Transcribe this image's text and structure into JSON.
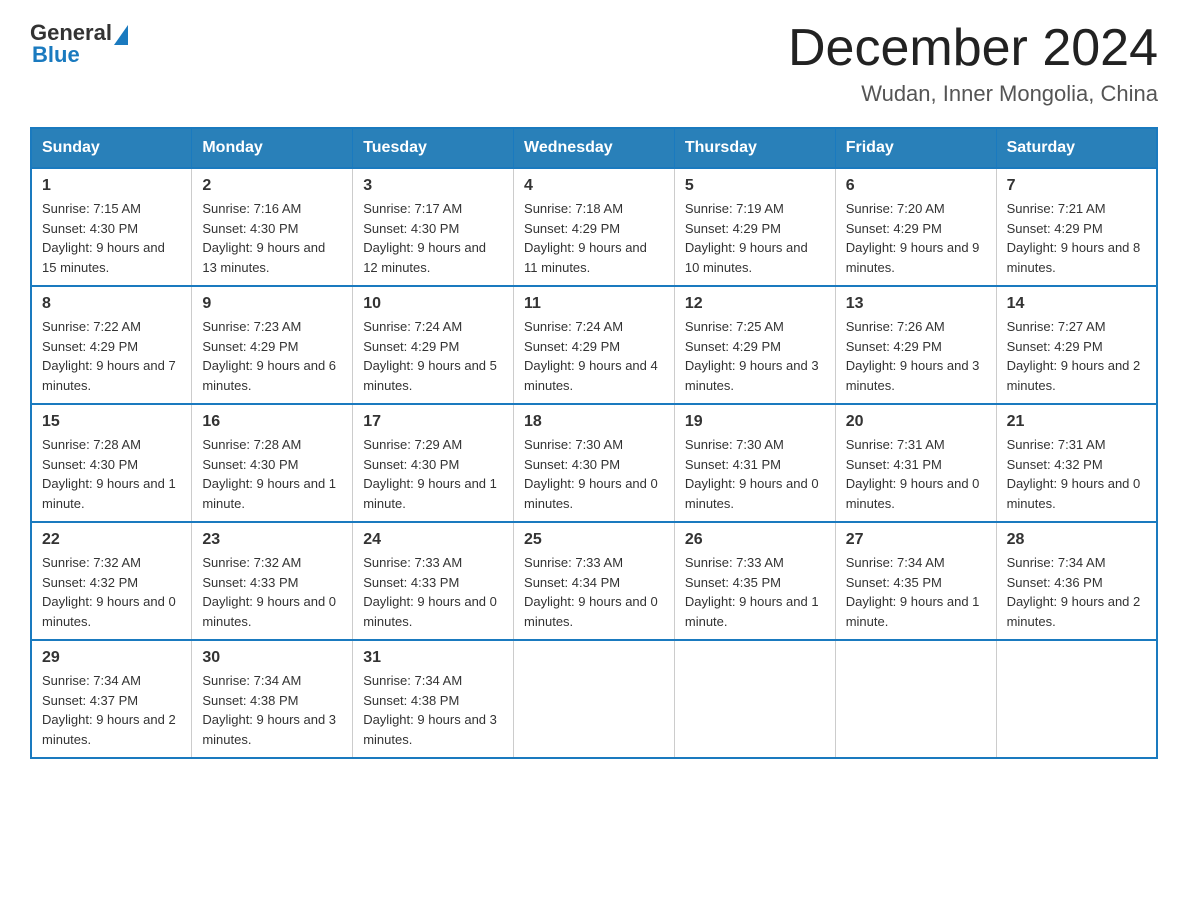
{
  "header": {
    "logo_general": "General",
    "logo_blue": "Blue",
    "month_title": "December 2024",
    "location": "Wudan, Inner Mongolia, China"
  },
  "weekdays": [
    "Sunday",
    "Monday",
    "Tuesday",
    "Wednesday",
    "Thursday",
    "Friday",
    "Saturday"
  ],
  "weeks": [
    [
      {
        "day": "1",
        "sunrise": "7:15 AM",
        "sunset": "4:30 PM",
        "daylight": "9 hours and 15 minutes."
      },
      {
        "day": "2",
        "sunrise": "7:16 AM",
        "sunset": "4:30 PM",
        "daylight": "9 hours and 13 minutes."
      },
      {
        "day": "3",
        "sunrise": "7:17 AM",
        "sunset": "4:30 PM",
        "daylight": "9 hours and 12 minutes."
      },
      {
        "day": "4",
        "sunrise": "7:18 AM",
        "sunset": "4:29 PM",
        "daylight": "9 hours and 11 minutes."
      },
      {
        "day": "5",
        "sunrise": "7:19 AM",
        "sunset": "4:29 PM",
        "daylight": "9 hours and 10 minutes."
      },
      {
        "day": "6",
        "sunrise": "7:20 AM",
        "sunset": "4:29 PM",
        "daylight": "9 hours and 9 minutes."
      },
      {
        "day": "7",
        "sunrise": "7:21 AM",
        "sunset": "4:29 PM",
        "daylight": "9 hours and 8 minutes."
      }
    ],
    [
      {
        "day": "8",
        "sunrise": "7:22 AM",
        "sunset": "4:29 PM",
        "daylight": "9 hours and 7 minutes."
      },
      {
        "day": "9",
        "sunrise": "7:23 AM",
        "sunset": "4:29 PM",
        "daylight": "9 hours and 6 minutes."
      },
      {
        "day": "10",
        "sunrise": "7:24 AM",
        "sunset": "4:29 PM",
        "daylight": "9 hours and 5 minutes."
      },
      {
        "day": "11",
        "sunrise": "7:24 AM",
        "sunset": "4:29 PM",
        "daylight": "9 hours and 4 minutes."
      },
      {
        "day": "12",
        "sunrise": "7:25 AM",
        "sunset": "4:29 PM",
        "daylight": "9 hours and 3 minutes."
      },
      {
        "day": "13",
        "sunrise": "7:26 AM",
        "sunset": "4:29 PM",
        "daylight": "9 hours and 3 minutes."
      },
      {
        "day": "14",
        "sunrise": "7:27 AM",
        "sunset": "4:29 PM",
        "daylight": "9 hours and 2 minutes."
      }
    ],
    [
      {
        "day": "15",
        "sunrise": "7:28 AM",
        "sunset": "4:30 PM",
        "daylight": "9 hours and 1 minute."
      },
      {
        "day": "16",
        "sunrise": "7:28 AM",
        "sunset": "4:30 PM",
        "daylight": "9 hours and 1 minute."
      },
      {
        "day": "17",
        "sunrise": "7:29 AM",
        "sunset": "4:30 PM",
        "daylight": "9 hours and 1 minute."
      },
      {
        "day": "18",
        "sunrise": "7:30 AM",
        "sunset": "4:30 PM",
        "daylight": "9 hours and 0 minutes."
      },
      {
        "day": "19",
        "sunrise": "7:30 AM",
        "sunset": "4:31 PM",
        "daylight": "9 hours and 0 minutes."
      },
      {
        "day": "20",
        "sunrise": "7:31 AM",
        "sunset": "4:31 PM",
        "daylight": "9 hours and 0 minutes."
      },
      {
        "day": "21",
        "sunrise": "7:31 AM",
        "sunset": "4:32 PM",
        "daylight": "9 hours and 0 minutes."
      }
    ],
    [
      {
        "day": "22",
        "sunrise": "7:32 AM",
        "sunset": "4:32 PM",
        "daylight": "9 hours and 0 minutes."
      },
      {
        "day": "23",
        "sunrise": "7:32 AM",
        "sunset": "4:33 PM",
        "daylight": "9 hours and 0 minutes."
      },
      {
        "day": "24",
        "sunrise": "7:33 AM",
        "sunset": "4:33 PM",
        "daylight": "9 hours and 0 minutes."
      },
      {
        "day": "25",
        "sunrise": "7:33 AM",
        "sunset": "4:34 PM",
        "daylight": "9 hours and 0 minutes."
      },
      {
        "day": "26",
        "sunrise": "7:33 AM",
        "sunset": "4:35 PM",
        "daylight": "9 hours and 1 minute."
      },
      {
        "day": "27",
        "sunrise": "7:34 AM",
        "sunset": "4:35 PM",
        "daylight": "9 hours and 1 minute."
      },
      {
        "day": "28",
        "sunrise": "7:34 AM",
        "sunset": "4:36 PM",
        "daylight": "9 hours and 2 minutes."
      }
    ],
    [
      {
        "day": "29",
        "sunrise": "7:34 AM",
        "sunset": "4:37 PM",
        "daylight": "9 hours and 2 minutes."
      },
      {
        "day": "30",
        "sunrise": "7:34 AM",
        "sunset": "4:38 PM",
        "daylight": "9 hours and 3 minutes."
      },
      {
        "day": "31",
        "sunrise": "7:34 AM",
        "sunset": "4:38 PM",
        "daylight": "9 hours and 3 minutes."
      },
      null,
      null,
      null,
      null
    ]
  ]
}
